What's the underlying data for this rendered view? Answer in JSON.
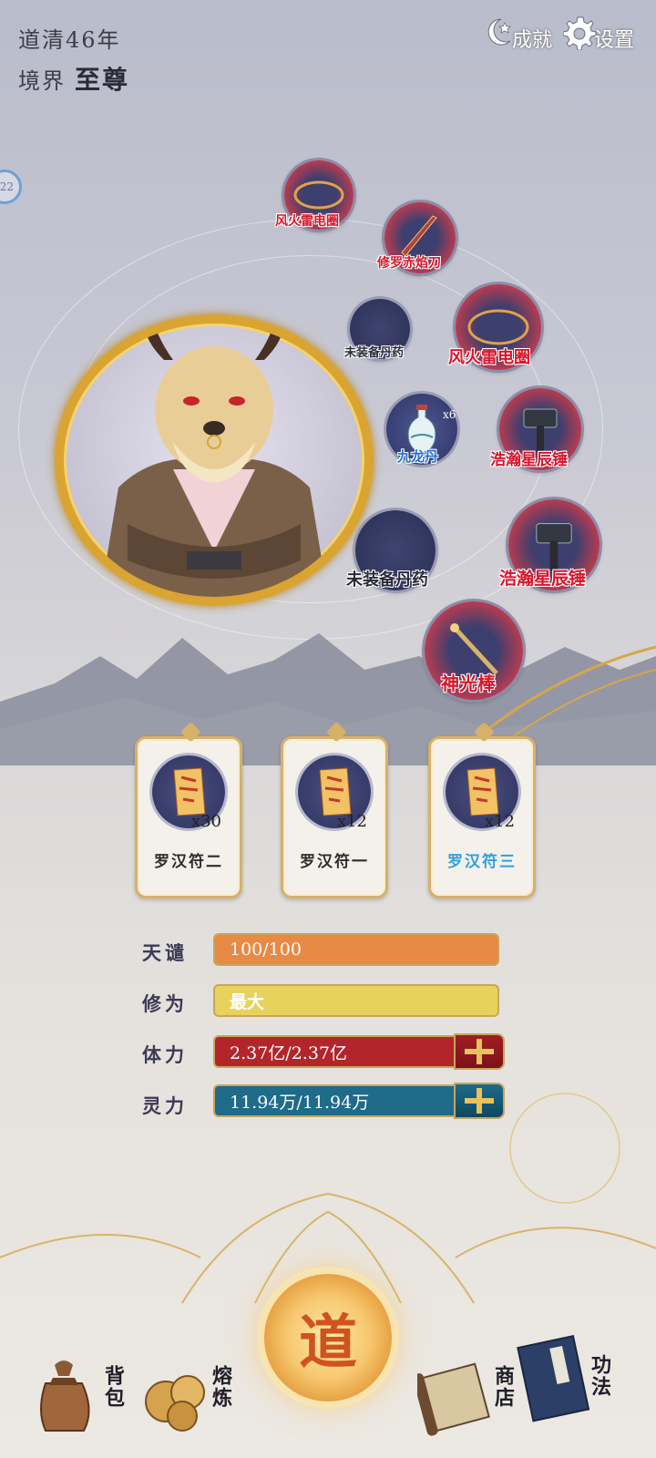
{
  "header": {
    "year_text": "道清46年",
    "realm_label": "境界",
    "realm_value": "至尊",
    "achievements_label": "成就",
    "settings_label": "设置",
    "side_badge": "22"
  },
  "equipment": {
    "slot1": "风火雷电圈",
    "slot2": "修罗赤焰刀",
    "slot3": "未装备丹药",
    "slot4": "风火雷电圈",
    "slot5": "九龙丹",
    "slot5_count": "x6",
    "slot6": "浩瀚星辰锤",
    "slot7": "未装备丹药",
    "slot8": "浩瀚星辰锤",
    "slot9": "神光棒"
  },
  "talismans": [
    {
      "name": "罗汉符二",
      "count": "x30"
    },
    {
      "name": "罗汉符一",
      "count": "x12"
    },
    {
      "name": "罗汉符三",
      "count": "x12"
    }
  ],
  "stats": {
    "tianqian_label": "天谴",
    "tianqian_value": "100/100",
    "xiuwei_label": "修为",
    "xiuwei_value": "最大",
    "tili_label": "体力",
    "tili_value": "2.37亿/2.37亿",
    "lingli_label": "灵力",
    "lingli_value": "11.94万/11.94万"
  },
  "nav": {
    "bag_label": "背包",
    "smelt_label": "熔炼",
    "dao_label": "道",
    "shop_label": "商店",
    "skill_label": "功法"
  },
  "colors": {
    "gold_frame": "#d9a431",
    "label_red": "#d8142a",
    "hp_bar": "#b1252b",
    "mp_bar": "#1e6b8a",
    "exp_bar": "#e78a46",
    "cult_bar": "#e7d25c"
  }
}
